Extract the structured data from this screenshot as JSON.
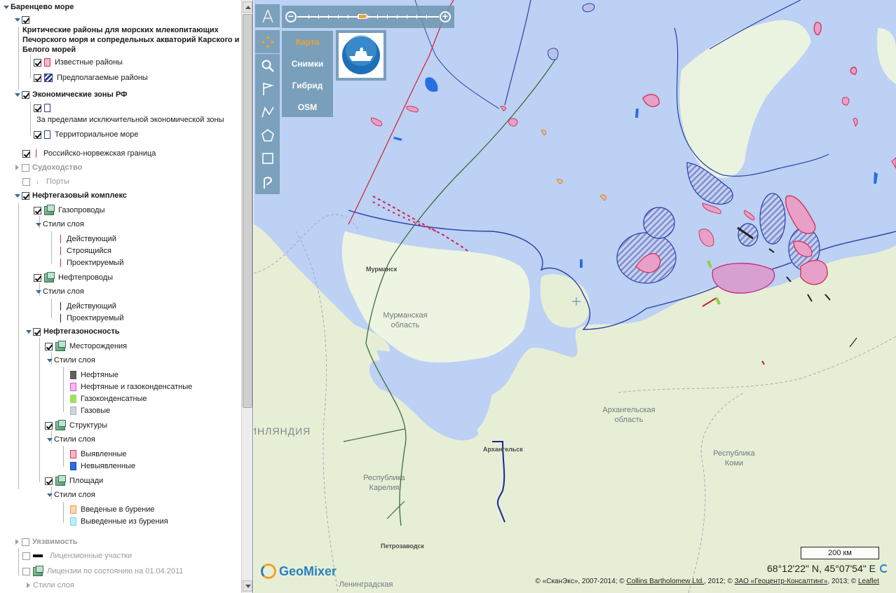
{
  "tree": {
    "barents": "Баренцево море",
    "critical_title": "Критические районы для морских млекопитающих Печорского моря и сопредельных акваторий Карского и Белого морей",
    "known_areas": "Известные районы",
    "assumed_areas": "Предполагаемые районы",
    "econ_zones": "Экономические зоны РФ",
    "outside_eez": "За пределами исключительной экономической зоны",
    "territorial_sea": "Территориальное море",
    "ru_no_border": "Российско-норвежская граница",
    "shipping": "Судоходство",
    "ports": "Порты",
    "oilgas_complex": "Нефтегазовый комплекс",
    "gas_pipelines": "Газопроводы",
    "layer_styles": "Стили слоя",
    "operating": "Действующий",
    "under_construction": "Строящийся",
    "planned": "Проектируемый",
    "oil_pipelines": "Нефтепроводы",
    "oilgas_potential": "Нефтегазоносность",
    "deposits": "Месторождения",
    "oil": "Нефтяные",
    "oil_condensate": "Нефтяные и газоконденсатные",
    "gas_condensate": "Газоконденсатные",
    "gas": "Газовые",
    "structures": "Структуры",
    "identified": "Выявленные",
    "unidentified": "Невыявленные",
    "areas": "Площади",
    "drilling_in": "Введеные в бурение",
    "drilling_out": "Выведенные из бурения",
    "vulnerability": "Уязвимость",
    "license_areas": "Лицензионные участки",
    "licenses_2011": "Лицензии по состоянию на 01.04.2011",
    "layer_styles_last": "Стили слоя"
  },
  "colors": {
    "known": "#f06a8a",
    "oil": "#606060",
    "oil_condensate": "#f070e0",
    "gas_condensate": "#a0e060",
    "gas": "#c8ccd8",
    "identified": "#f06a8a",
    "unidentified": "#2a6fe0",
    "drill_in": "#f0b870",
    "drill_out": "#90e8f0",
    "sea": "#bcd1f3",
    "land": "#e8f0d8"
  },
  "map": {
    "basemaps": [
      "Карта",
      "Снимки",
      "Гибрид",
      "OSM"
    ],
    "active_basemap": "Карта",
    "labels": {
      "murmansk_obl": "Мурманская\nобласть",
      "arkh_obl": "Архангельская\nобласть",
      "komi": "Республика\nКоми",
      "karelia": "Республика\nКарелия",
      "finland": "ИНЛЯНДИЯ",
      "leningrad": "Ленинградская",
      "murmansk": "Мурманск",
      "arkhangelsk": "Архангельск",
      "petrozavodsk": "Петрозаводск"
    },
    "scale": "200 км",
    "coords": "68°12'22\" N, 45°07'54\" E",
    "logo": "GeoMixer",
    "copyright": {
      "c1": "© «СканЭкс», 2007-2014; ©",
      "c2": "Collins Bartholomew Ltd.",
      "c3": ", 2012; ©",
      "c4": "ЗАО «Геоцентр-Консалтинг»",
      "c5": ", 2013; ©",
      "c6": "Leaflet"
    }
  }
}
